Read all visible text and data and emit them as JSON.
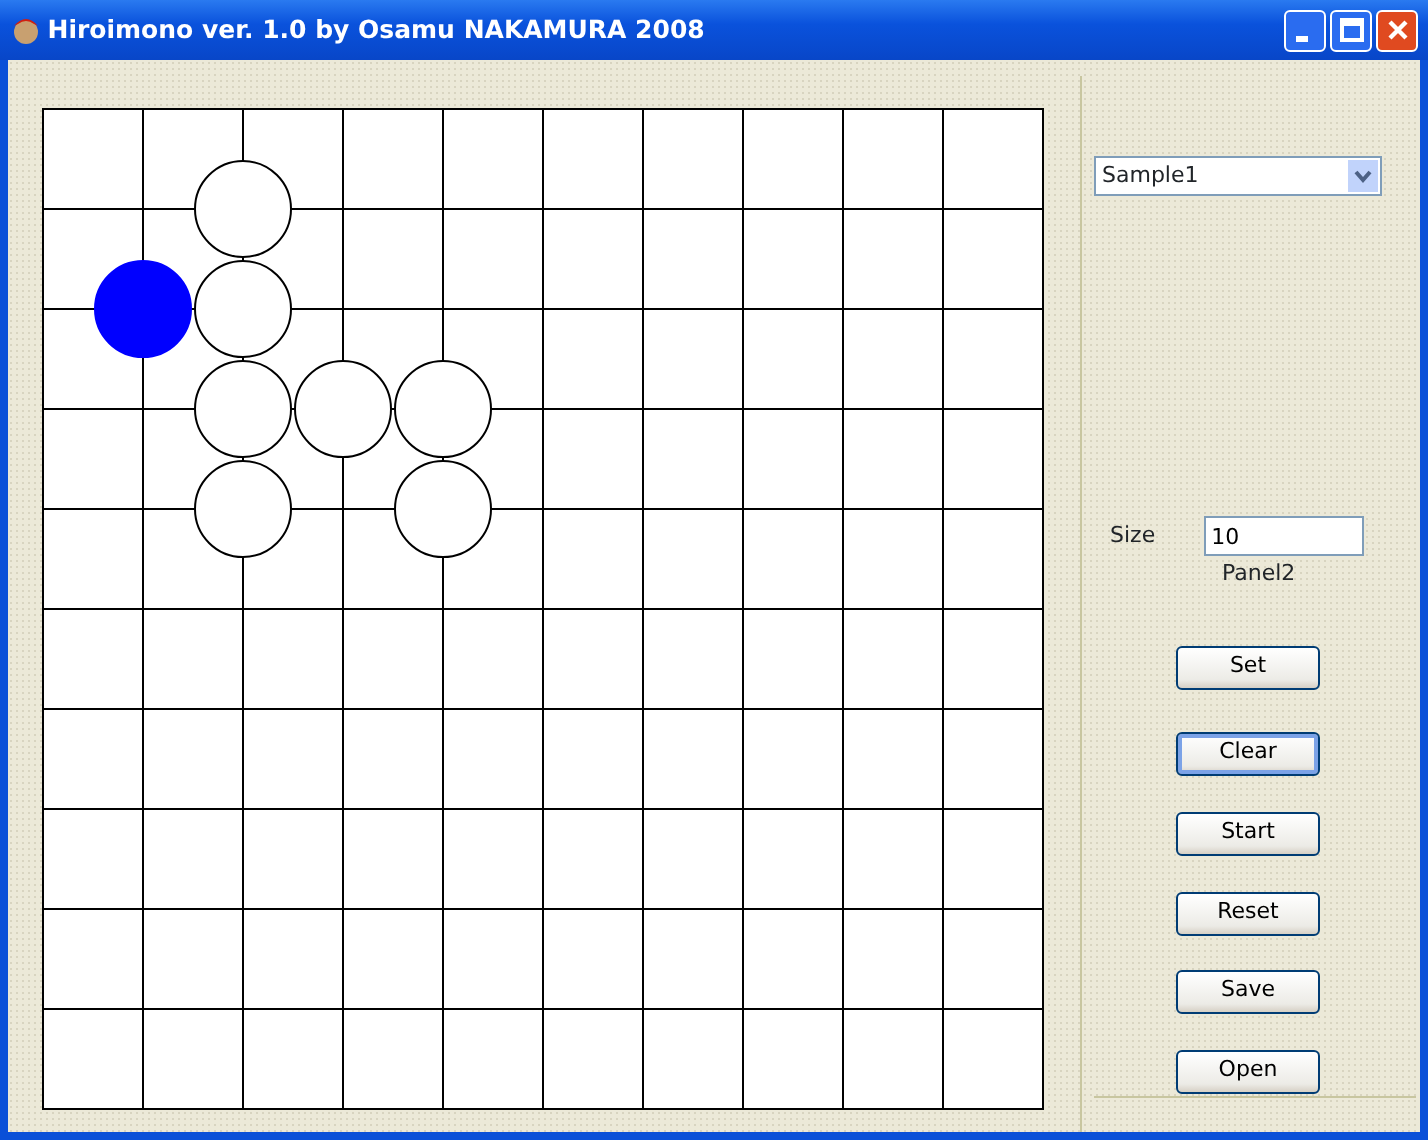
{
  "window": {
    "title": "Hiroimono ver. 1.0 by Osamu NAKAMURA  2008"
  },
  "board": {
    "rows": [
      {
        "points": [
          {
            "kind": "empty"
          },
          {
            "kind": "empty"
          },
          {
            "kind": "empty"
          },
          {
            "kind": "empty"
          },
          {
            "kind": "empty"
          },
          {
            "kind": "empty"
          },
          {
            "kind": "empty"
          },
          {
            "kind": "empty"
          },
          {
            "kind": "empty"
          },
          {
            "kind": "empty"
          },
          {
            "kind": "empty"
          }
        ]
      },
      {
        "points": [
          {
            "kind": "empty"
          },
          {
            "kind": "empty"
          },
          {
            "kind": "white"
          },
          {
            "kind": "empty"
          },
          {
            "kind": "empty"
          },
          {
            "kind": "empty"
          },
          {
            "kind": "empty"
          },
          {
            "kind": "empty"
          },
          {
            "kind": "empty"
          },
          {
            "kind": "empty"
          },
          {
            "kind": "empty"
          }
        ]
      },
      {
        "points": [
          {
            "kind": "empty"
          },
          {
            "kind": "blue"
          },
          {
            "kind": "white"
          },
          {
            "kind": "empty"
          },
          {
            "kind": "empty"
          },
          {
            "kind": "empty"
          },
          {
            "kind": "empty"
          },
          {
            "kind": "empty"
          },
          {
            "kind": "empty"
          },
          {
            "kind": "empty"
          },
          {
            "kind": "empty"
          }
        ]
      },
      {
        "points": [
          {
            "kind": "empty"
          },
          {
            "kind": "empty"
          },
          {
            "kind": "white"
          },
          {
            "kind": "white"
          },
          {
            "kind": "white"
          },
          {
            "kind": "empty"
          },
          {
            "kind": "empty"
          },
          {
            "kind": "empty"
          },
          {
            "kind": "empty"
          },
          {
            "kind": "empty"
          },
          {
            "kind": "empty"
          }
        ]
      },
      {
        "points": [
          {
            "kind": "empty"
          },
          {
            "kind": "empty"
          },
          {
            "kind": "white"
          },
          {
            "kind": "empty"
          },
          {
            "kind": "white"
          },
          {
            "kind": "empty"
          },
          {
            "kind": "empty"
          },
          {
            "kind": "empty"
          },
          {
            "kind": "empty"
          },
          {
            "kind": "empty"
          },
          {
            "kind": "empty"
          }
        ]
      },
      {
        "points": [
          {
            "kind": "empty"
          },
          {
            "kind": "empty"
          },
          {
            "kind": "empty"
          },
          {
            "kind": "empty"
          },
          {
            "kind": "empty"
          },
          {
            "kind": "empty"
          },
          {
            "kind": "empty"
          },
          {
            "kind": "empty"
          },
          {
            "kind": "empty"
          },
          {
            "kind": "empty"
          },
          {
            "kind": "empty"
          }
        ]
      },
      {
        "points": [
          {
            "kind": "empty"
          },
          {
            "kind": "empty"
          },
          {
            "kind": "empty"
          },
          {
            "kind": "empty"
          },
          {
            "kind": "empty"
          },
          {
            "kind": "empty"
          },
          {
            "kind": "empty"
          },
          {
            "kind": "empty"
          },
          {
            "kind": "empty"
          },
          {
            "kind": "empty"
          },
          {
            "kind": "empty"
          }
        ]
      },
      {
        "points": [
          {
            "kind": "empty"
          },
          {
            "kind": "empty"
          },
          {
            "kind": "empty"
          },
          {
            "kind": "empty"
          },
          {
            "kind": "empty"
          },
          {
            "kind": "empty"
          },
          {
            "kind": "empty"
          },
          {
            "kind": "empty"
          },
          {
            "kind": "empty"
          },
          {
            "kind": "empty"
          },
          {
            "kind": "empty"
          }
        ]
      },
      {
        "points": [
          {
            "kind": "empty"
          },
          {
            "kind": "empty"
          },
          {
            "kind": "empty"
          },
          {
            "kind": "empty"
          },
          {
            "kind": "empty"
          },
          {
            "kind": "empty"
          },
          {
            "kind": "empty"
          },
          {
            "kind": "empty"
          },
          {
            "kind": "empty"
          },
          {
            "kind": "empty"
          },
          {
            "kind": "empty"
          }
        ]
      },
      {
        "points": [
          {
            "kind": "empty"
          },
          {
            "kind": "empty"
          },
          {
            "kind": "empty"
          },
          {
            "kind": "empty"
          },
          {
            "kind": "empty"
          },
          {
            "kind": "empty"
          },
          {
            "kind": "empty"
          },
          {
            "kind": "empty"
          },
          {
            "kind": "empty"
          },
          {
            "kind": "empty"
          },
          {
            "kind": "empty"
          }
        ]
      },
      {
        "points": [
          {
            "kind": "empty"
          },
          {
            "kind": "empty"
          },
          {
            "kind": "empty"
          },
          {
            "kind": "empty"
          },
          {
            "kind": "empty"
          },
          {
            "kind": "empty"
          },
          {
            "kind": "empty"
          },
          {
            "kind": "empty"
          },
          {
            "kind": "empty"
          },
          {
            "kind": "empty"
          },
          {
            "kind": "empty"
          }
        ]
      }
    ]
  },
  "sample_dropdown": {
    "value": "Sample1"
  },
  "size_field": {
    "label": "Size",
    "value": "10"
  },
  "panel_label": "Panel2",
  "buttons": [
    {
      "label": "Set",
      "focused": false
    },
    {
      "label": "Clear",
      "focused": true
    },
    {
      "label": "Start",
      "focused": false
    },
    {
      "label": "Reset",
      "focused": false
    },
    {
      "label": "Save",
      "focused": false
    },
    {
      "label": "Open",
      "focused": false
    }
  ]
}
